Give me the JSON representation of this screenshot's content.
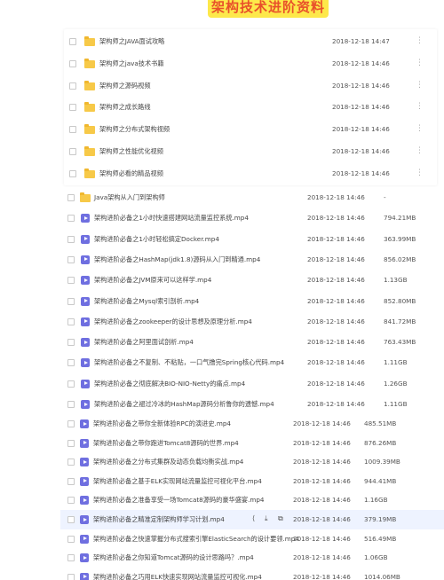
{
  "banner": {
    "title": "架构技术进阶资料"
  },
  "folders": [
    {
      "name": "架构师之JAVA面试攻略",
      "date": "2018-12-18 14:47",
      "more": "⋮"
    },
    {
      "name": "架构师之java技术书籍",
      "date": "2018-12-18 14:46",
      "more": "⋮"
    },
    {
      "name": "架构师之源码视频",
      "date": "2018-12-18 14:46",
      "more": "⋮"
    },
    {
      "name": "架构师之成长路线",
      "date": "2018-12-18 14:46",
      "more": "⋮"
    },
    {
      "name": "架构师之分布式架构视频",
      "date": "2018-12-18 14:46",
      "more": "⋮"
    },
    {
      "name": "架构师之性能优化视频",
      "date": "2018-12-18 14:46",
      "more": "⋮"
    },
    {
      "name": "架构师必看的精品视频",
      "date": "2018-12-18 14:46",
      "more": "⋮"
    }
  ],
  "list2": [
    {
      "type": "folder",
      "name": "Java架构从入门到架构师",
      "date": "2018-12-18 14:46",
      "size": "-"
    },
    {
      "type": "video",
      "name": "架构进阶必备之1小时快速搭建网站流量监控系统.mp4",
      "date": "2018-12-18 14:46",
      "size": "794.21MB"
    },
    {
      "type": "video",
      "name": "架构进阶必备之1小时轻松搞定Docker.mp4",
      "date": "2018-12-18 14:46",
      "size": "363.99MB"
    },
    {
      "type": "video",
      "name": "架构进阶必备之HashMap(jdk1.8)源码从入门到精通.mp4",
      "date": "2018-12-18 14:46",
      "size": "856.02MB"
    },
    {
      "type": "video",
      "name": "架构进阶必备之JVM原来可以这样学.mp4",
      "date": "2018-12-18 14:46",
      "size": "1.13GB"
    },
    {
      "type": "video",
      "name": "架构进阶必备之Mysql索引剖析.mp4",
      "date": "2018-12-18 14:46",
      "size": "852.80MB"
    },
    {
      "type": "video",
      "name": "架构进阶必备之zookeeper的设计思想及原理分析.mp4",
      "date": "2018-12-18 14:46",
      "size": "841.72MB"
    },
    {
      "type": "video",
      "name": "架构进阶必备之阿里面试剖析.mp4",
      "date": "2018-12-18 14:46",
      "size": "763.43MB"
    },
    {
      "type": "video",
      "name": "架构进阶必备之不复制、不粘贴，一口气撸完Spring核心代码.mp4",
      "date": "2018-12-18 14:46",
      "size": "1.11GB"
    },
    {
      "type": "video",
      "name": "架构进阶必备之彻底解决BIO-NIO-Netty的痛点.mp4",
      "date": "2018-12-18 14:46",
      "size": "1.26GB"
    },
    {
      "type": "video",
      "name": "架构进阶必备之褪过冷冰的HashMap源码分析鲁你的遗憾.mp4",
      "date": "2018-12-18 14:46",
      "size": "1.11GB"
    }
  ],
  "list3": [
    {
      "name": "架构进阶必备之带你全新体验RPC的演进史.mp4",
      "date": "2018-12-18 14:46",
      "size": "485.51MB"
    },
    {
      "name": "架构进阶必备之带你跑进Tomcat8源码的世界.mp4",
      "date": "2018-12-18 14:46",
      "size": "876.26MB"
    },
    {
      "name": "架构进阶必备之分布式集群及动态负载均衡实战.mp4",
      "date": "2018-12-18 14:46",
      "size": "1009.39MB"
    },
    {
      "name": "架构进阶必备之基于ELK实现网站流量监控可视化平台.mp4",
      "date": "2018-12-18 14:46",
      "size": "944.41MB"
    },
    {
      "name": "架构进阶必备之准备享受一场Tomcat8源码的豪华盛宴.mp4",
      "date": "2018-12-18 14:46",
      "size": "1.16GB"
    },
    {
      "name": "架构进阶必备之精准定制架构师学习计划.mp4",
      "date": "2018-12-18 14:46",
      "size": "379.19MB"
    },
    {
      "name": "架构进阶必备之快速掌握分布式搜索引擎ElasticSearch的设计要领.mp4",
      "date": "2018-12-18 14:46",
      "size": "516.49MB"
    },
    {
      "name": "架构进阶必备之你知道Tomcat源码的设计思路吗？.mp4",
      "date": "2018-12-18 14:46",
      "size": "1.06GB"
    },
    {
      "name": "架构进阶必备之巧用ELK快速实现网站流量监控可视化.mp4",
      "date": "2018-12-18 14:46",
      "size": "1014.06MB"
    }
  ],
  "row_actions": {
    "share": "⟨",
    "download": "⤓",
    "copy": "⧉",
    "delete": "🗑"
  },
  "colors": {
    "folder": "#f7c948",
    "video": "#6f6fe0",
    "banner_bg": "#fde84a",
    "banner_text": "#e8502a",
    "highlight": "#eef3ff"
  }
}
